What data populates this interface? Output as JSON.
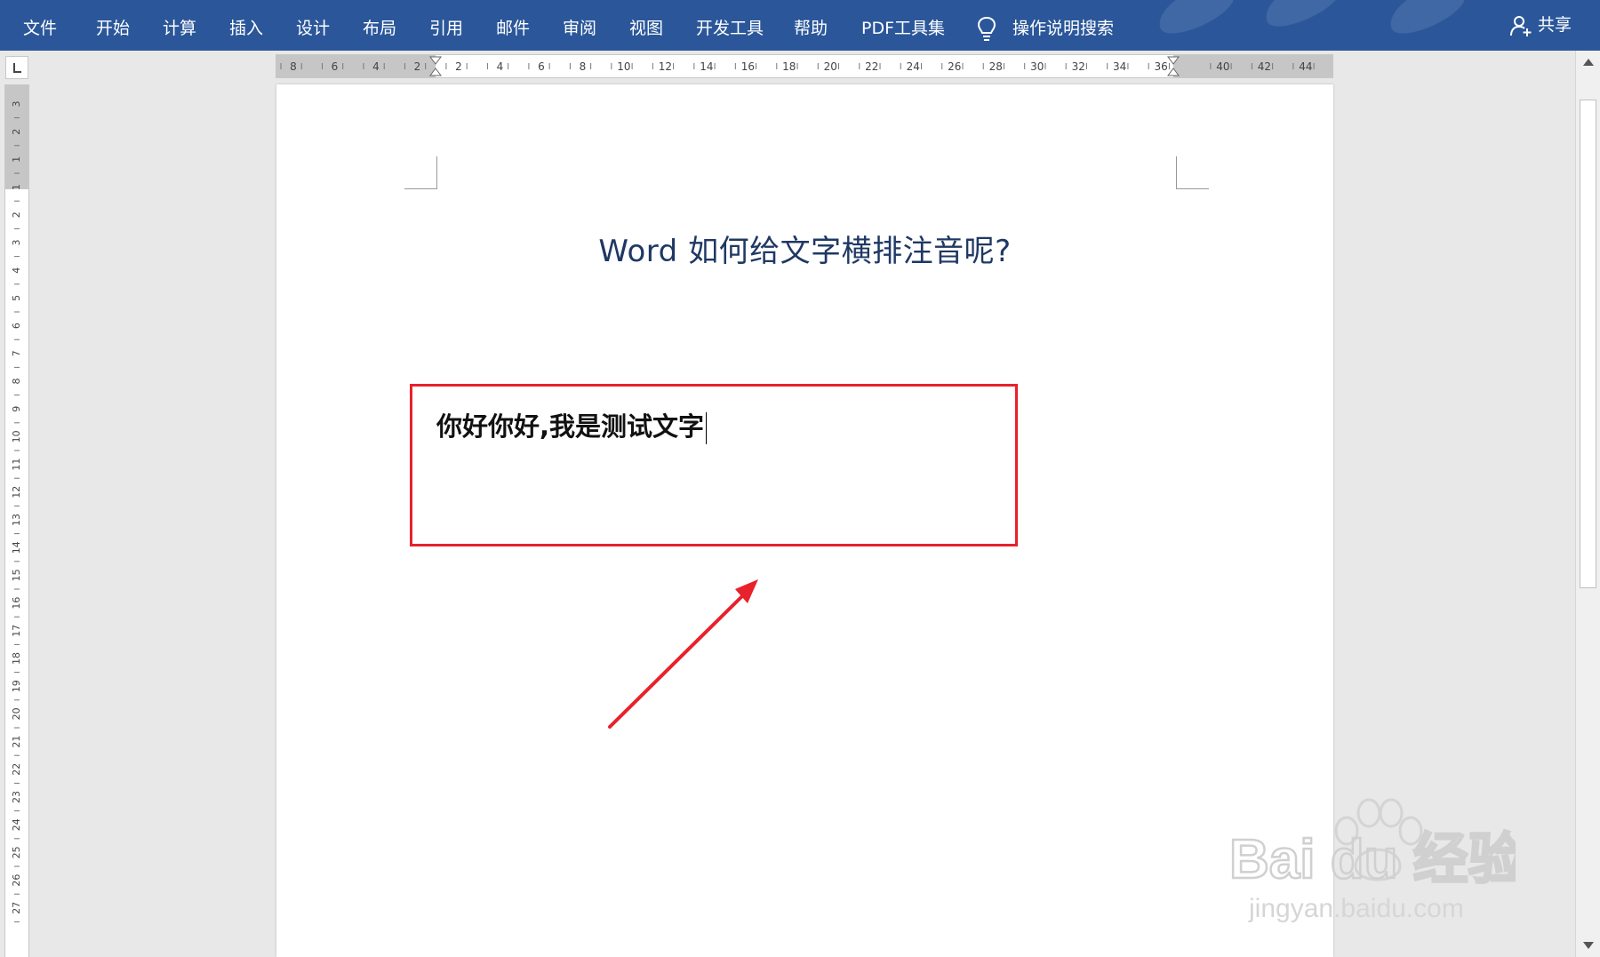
{
  "ribbon": {
    "tabs": [
      "文件",
      "开始",
      "计算",
      "插入",
      "设计",
      "布局",
      "引用",
      "邮件",
      "审阅",
      "视图",
      "开发工具",
      "帮助",
      "PDF工具集"
    ],
    "search_label": "操作说明搜索",
    "share_label": "共享"
  },
  "ruler": {
    "h_labels": [
      "8",
      "6",
      "4",
      "2",
      "2",
      "4",
      "6",
      "8",
      "10",
      "12",
      "14",
      "16",
      "18",
      "20",
      "22",
      "24",
      "26",
      "28",
      "30",
      "32",
      "34",
      "36",
      "40",
      "42",
      "44"
    ],
    "v_labels": [
      "3",
      "2",
      "1",
      "1",
      "2",
      "3",
      "4",
      "5",
      "6",
      "7",
      "8",
      "9",
      "10",
      "11",
      "12",
      "13",
      "14",
      "15",
      "16",
      "17",
      "18",
      "19",
      "20",
      "21",
      "22",
      "23",
      "24",
      "25",
      "26",
      "27"
    ]
  },
  "document": {
    "title": "Word 如何给文字横排注音呢?",
    "textbox_text": "你好你好,我是测试文字"
  },
  "watermark": {
    "brand": "Bai du 经验",
    "url": "jingyan.baidu.com"
  },
  "colors": {
    "ribbon": "#2b579a",
    "title": "#1f3864",
    "highlight": "#e8212b"
  }
}
